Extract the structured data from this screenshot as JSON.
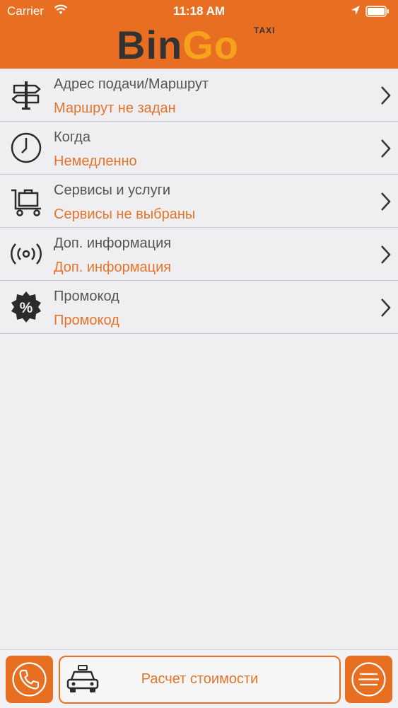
{
  "status_bar": {
    "carrier": "Carrier",
    "time": "11:18 AM"
  },
  "header": {
    "logo_part1": "Bin",
    "logo_part2": "Go",
    "logo_tag": "TAXI",
    "background_color": "#e86f22"
  },
  "menu": {
    "items": [
      {
        "icon": "signpost-icon",
        "title": "Адрес подачи/Маршрут",
        "value": "Маршрут не задан"
      },
      {
        "icon": "clock-icon",
        "title": "Когда",
        "value": "Немедленно"
      },
      {
        "icon": "cart-icon",
        "title": "Сервисы и услуги",
        "value": "Сервисы не выбраны"
      },
      {
        "icon": "broadcast-icon",
        "title": "Доп. информация",
        "value": "Доп. информация"
      },
      {
        "icon": "percent-badge-icon",
        "title": "Промокод",
        "value": "Промокод"
      }
    ]
  },
  "bottom_bar": {
    "call_icon": "phone-icon",
    "calculate_label": "Расчет стоимости",
    "calculate_icon": "taxi-car-icon",
    "menu_icon": "menu-icon"
  },
  "colors": {
    "accent": "#e86f22",
    "value_text": "#e4742b",
    "title_text": "#555555"
  }
}
